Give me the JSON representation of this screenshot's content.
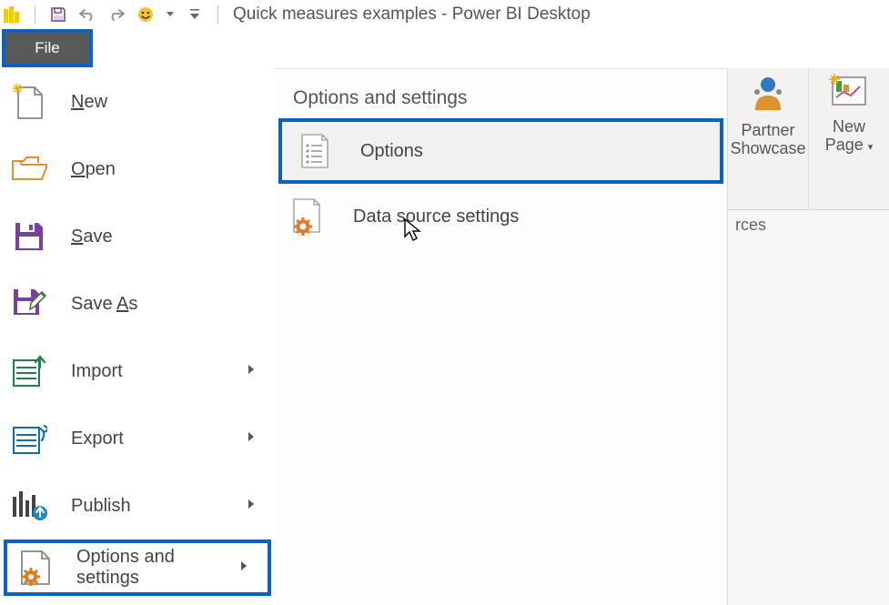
{
  "titlebar": {
    "title": "Quick measures examples - Power BI Desktop"
  },
  "file_tab": {
    "label": "File"
  },
  "left_menu": {
    "new": "New",
    "open": "Open",
    "save": "Save",
    "save_as": "Save As",
    "import": "Import",
    "export": "Export",
    "publish": "Publish",
    "options_settings": "Options and settings"
  },
  "sub_panel": {
    "title": "Options and settings",
    "options": "Options",
    "data_source": "Data source settings"
  },
  "right_ribbon": {
    "partner": "Partner Showcase",
    "new_page": "New Page",
    "sources_partial": "rces"
  }
}
